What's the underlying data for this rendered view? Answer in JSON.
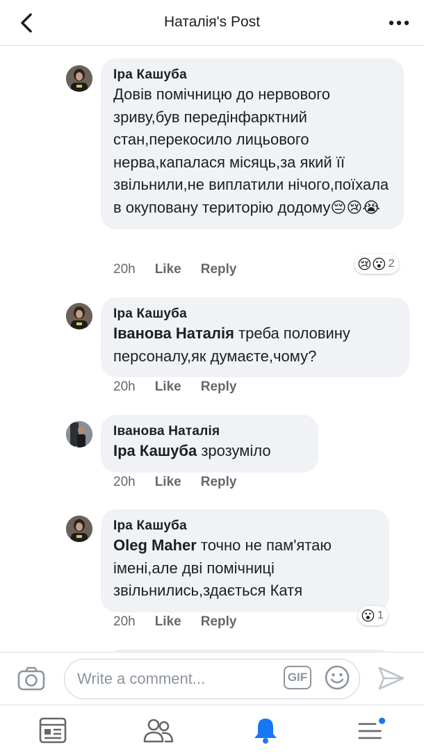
{
  "header": {
    "title": "Наталія's Post"
  },
  "comments": [
    {
      "author": "Іра Кашуба",
      "text": "Довів помічницю до нервового зриву,був передінфарктний стан,перекосило лицьового нерва,капалася місяць,за який її звільнили,не виплатили нічого,поїхала в окуповану територію додому",
      "emojis": "😔😢😭",
      "time": "20h",
      "like_label": "Like",
      "reply_label": "Reply",
      "reactions": "😢😮",
      "reaction_count": "2"
    },
    {
      "author": "Іра Кашуба",
      "mention": "Іванова Наталія",
      "text": " треба половину персоналу,як думаєте,чому?",
      "time": "20h",
      "like_label": "Like",
      "reply_label": "Reply"
    },
    {
      "author": "Іванова Наталія",
      "mention": "Іра Кашуба",
      "text": " зрозуміло",
      "time": "20h",
      "like_label": "Like",
      "reply_label": "Reply"
    },
    {
      "author": "Іра Кашуба",
      "mention": "Oleg Maher",
      "text": " точно не пам'ятаю імені,але дві помічниці звільнились,здається Катя",
      "time": "20h",
      "like_label": "Like",
      "reply_label": "Reply",
      "reactions": "😮",
      "reaction_count": "1"
    }
  ],
  "composer": {
    "placeholder": "Write a comment...",
    "gif_label": "GIF"
  },
  "tabbar": {
    "items": [
      "news-feed",
      "friends",
      "notifications",
      "menu"
    ],
    "active": "notifications",
    "accent": "#1877f2"
  }
}
